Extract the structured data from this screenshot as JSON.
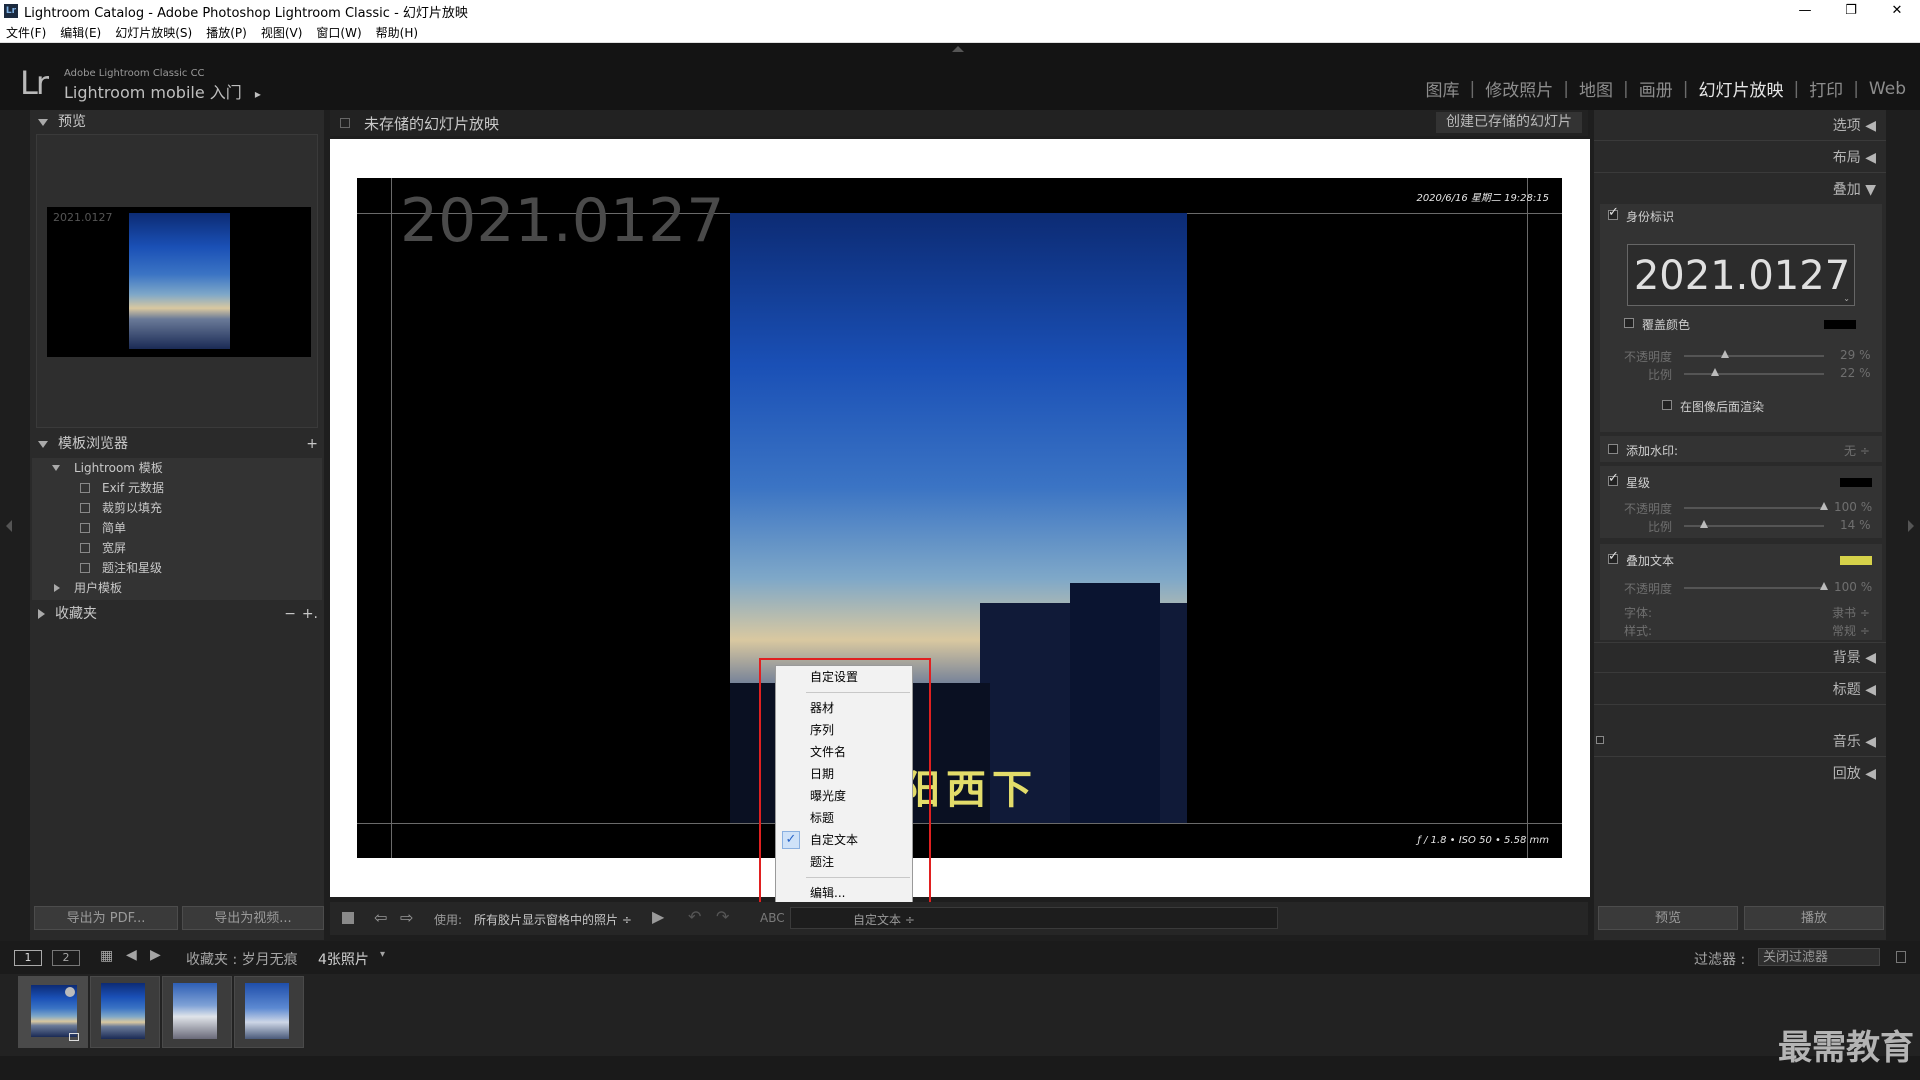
{
  "window": {
    "title": "Lightroom Catalog - Adobe Photoshop Lightroom Classic - 幻灯片放映",
    "app_icon": "Lr",
    "controls": [
      "—",
      "❐",
      "✕"
    ]
  },
  "menu": [
    "文件(F)",
    "编辑(E)",
    "幻灯片放映(S)",
    "播放(P)",
    "视图(V)",
    "窗口(W)",
    "帮助(H)"
  ],
  "header": {
    "logo": "Lr",
    "brand_small": "Adobe Lightroom Classic CC",
    "brand_big": "Lightroom mobile 入门",
    "brand_arrow": "▸",
    "modules": [
      "图库",
      "修改照片",
      "地图",
      "画册",
      "幻灯片放映",
      "打印",
      "Web"
    ],
    "active_module": "幻灯片放映"
  },
  "left": {
    "preview_title": "预览",
    "preview_label": "2021.0127",
    "template_browser_title": "模板浏览器",
    "add": "+",
    "lightroom_templates": "Lightroom 模板",
    "templates": [
      "Exif 元数据",
      "裁剪以填充",
      "简单",
      "宽屏",
      "题注和星级"
    ],
    "user_templates": "用户模板",
    "collections_title": "收藏夹",
    "collections_minus": "−",
    "collections_plus": "+.",
    "export_pdf": "导出为 PDF...",
    "export_video": "导出为视频..."
  },
  "center": {
    "doc_title": "未存储的幻灯片放映",
    "create_saved": "创建已存储的幻灯片",
    "identity_plate": "2021.0127",
    "date_text": "2020/6/16 星期二 19:28:15",
    "exif_text": "ƒ / 1.8 • ISO 50 • 5.58 mm",
    "overlay_text": "阳西下"
  },
  "dropdown": {
    "items": [
      "自定设置",
      "器材",
      "序列",
      "文件名",
      "日期",
      "曝光度",
      "标题",
      "自定文本",
      "题注",
      "编辑..."
    ],
    "checked": "自定文本",
    "check_mark": "✓"
  },
  "toolbar": {
    "use_label": "使用:",
    "use_value": "所有胶片显示窗格中的照片 ÷",
    "abc": "ABC",
    "custom_text": "自定文本 ÷"
  },
  "right": {
    "options": "选项",
    "layout": "布局",
    "overlays": "叠加",
    "identity_plate": "身份标识",
    "plate_text": "2021.0127",
    "override_color": "覆盖颜色",
    "opacity": "不透明度",
    "scale": "比例",
    "opacity_value": "29",
    "scale_value": "22",
    "percent": "%",
    "render_behind": "在图像后面渲染",
    "watermark": "添加水印:",
    "watermark_value": "无 ÷",
    "rating": "星级",
    "rating_opacity": "100",
    "rating_scale": "14",
    "text_overlays": "叠加文本",
    "text_opacity": "100",
    "font_label": "字体:",
    "font_value": "隶书 ÷",
    "style_label": "样式:",
    "style_value": "常规 ÷",
    "backdrop": "背景",
    "titles": "标题",
    "music": "音乐",
    "playback": "回放",
    "preview_btn": "预览",
    "play_btn": "播放",
    "opacity_fraction": 0.29,
    "scale_fraction": 0.22,
    "rating_opacity_fraction": 1.0,
    "rating_scale_fraction": 0.14,
    "text_opacity_fraction": 1.0,
    "colors": {
      "override": "#000000",
      "rating": "#000000",
      "text": "#d6d24a"
    }
  },
  "filmbar": {
    "page1": "1",
    "page2": "2",
    "collection": "收藏夹 : 岁月无痕",
    "count": "4张照片",
    "filter_label": "过滤器 :",
    "filter_value": "关闭过滤器"
  },
  "watermark": "最需教育"
}
